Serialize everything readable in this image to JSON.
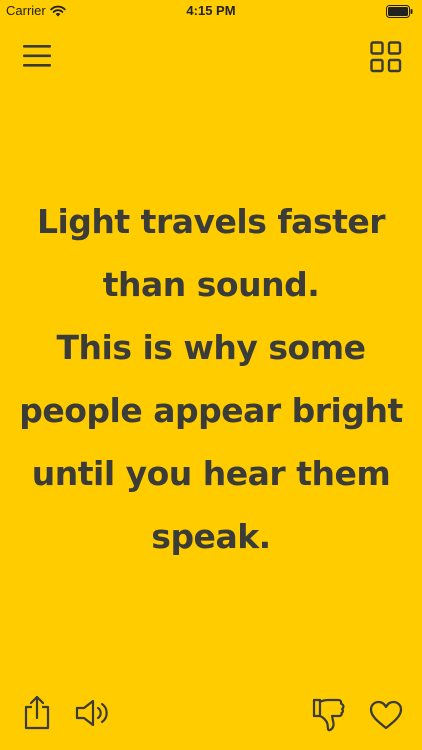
{
  "status_bar": {
    "carrier": "Carrier",
    "time": "4:15 PM"
  },
  "toolbar": {
    "menu_icon": "hamburger-menu-icon",
    "grid_icon": "grid-four-squares-icon"
  },
  "quote": {
    "lines": [
      "Light travels faster",
      "than sound.",
      "This is why some",
      "people appear bright",
      "until you hear them",
      "speak."
    ]
  },
  "bottom_bar": {
    "share_icon": "share-icon",
    "speaker_icon": "speaker-icon",
    "dislike_icon": "thumbs-down-icon",
    "like_icon": "heart-icon"
  },
  "colors": {
    "background": "#FFCC00",
    "foreground": "#3B3B38"
  }
}
